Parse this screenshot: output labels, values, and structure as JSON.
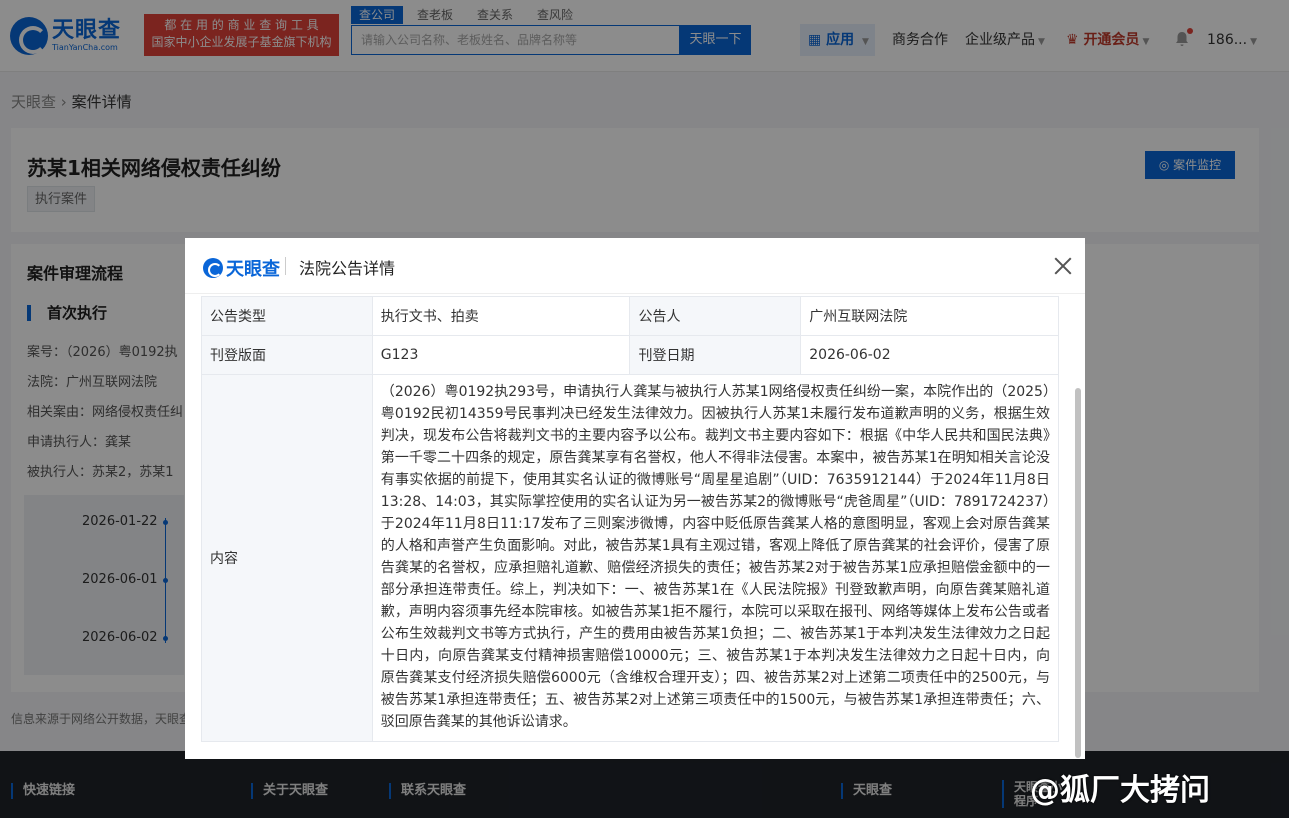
{
  "header": {
    "logo_cn": "天眼查",
    "logo_en": "TianYanCha.com",
    "slogan_line1": "都 在 用 的 商 业 查 询 工 具",
    "slogan_line2": "国家中小企业发展子基金旗下机构",
    "search_tabs": [
      "查公司",
      "查老板",
      "查关系",
      "查风险"
    ],
    "search_placeholder": "请输入公司名称、老板姓名、品牌名称等",
    "search_button": "天眼一下",
    "nav_apps": "应用",
    "nav_business": "商务合作",
    "nav_enterprise": "企业级产品",
    "nav_vip": "开通会员",
    "nav_user": "186..."
  },
  "breadcrumb": {
    "root": "天眼查",
    "sep": "›",
    "current": "案件详情"
  },
  "case": {
    "title": "苏某1相关网络侵权责任纠纷",
    "tag": "执行案件",
    "monitor_button": "案件监控"
  },
  "process": {
    "title": "案件审理流程",
    "subtitle": "首次执行",
    "fields": [
      "案号：（2026）粤0192执",
      "法院：广州互联网法院",
      "相关案由：网络侵权责任纠",
      "申请执行人：龚某",
      "被执行人：苏某2，苏某1"
    ],
    "dates": [
      "2026-01-22",
      "2026-06-01",
      "2026-06-02"
    ]
  },
  "disclaimer": "信息来源于网络公开数据，天眼查",
  "footer": {
    "items": [
      "快速链接",
      "关于天眼查",
      "联系天眼查",
      "天眼查",
      "天眼查小程序"
    ]
  },
  "watermark": "@狐厂大拷问",
  "modal": {
    "logo": "天眼查",
    "title": "法院公告详情",
    "rows": {
      "type_label": "公告类型",
      "type_value": "执行文书、拍卖",
      "publisher_label": "公告人",
      "publisher_value": "广州互联网法院",
      "page_label": "刊登版面",
      "page_value": "G123",
      "date_label": "刊登日期",
      "date_value": "2026-06-02",
      "content_label": "内容",
      "content_value": "（2026）粤0192执293号，申请执行人龚某与被执行人苏某1网络侵权责任纠纷一案，本院作出的（2025）粤0192民初14359号民事判决已经发生法律效力。因被执行人苏某1未履行发布道歉声明的义务，根据生效判决，现发布公告将裁判文书的主要内容予以公布。裁判文书主要内容如下：根据《中华人民共和国民法典》第一千零二十四条的规定，原告龚某享有名誉权，他人不得非法侵害。本案中，被告苏某1在明知相关言论没有事实依据的前提下，使用其实名认证的微博账号“周星星追剧”（UID：7635912144）于2024年11月8日13:28、14:03，其实际掌控使用的实名认证为另一被告苏某2的微博账号“虎爸周星”（UID：7891724237）于2024年11月8日11:17发布了三则案涉微博，内容中贬低原告龚某人格的意图明显，客观上会对原告龚某的人格和声誉产生负面影响。对此，被告苏某1具有主观过错，客观上降低了原告龚某的社会评价，侵害了原告龚某的名誉权，应承担赔礼道歉、赔偿经济损失的责任；被告苏某2对于被告苏某1应承担赔偿金额中的一部分承担连带责任。综上，判决如下：一、被告苏某1在《人民法院报》刊登致歉声明，向原告龚某赔礼道歉，声明内容须事先经本院审核。如被告苏某1拒不履行，本院可以采取在报刊、网络等媒体上发布公告或者公布生效裁判文书等方式执行，产生的费用由被告苏某1负担；二、被告苏某1于本判决发生法律效力之日起十日内，向原告龚某支付精神损害赔偿10000元；三、被告苏某1于本判决发生法律效力之日起十日内，向原告龚某支付经济损失赔偿6000元（含维权合理开支）；四、被告苏某2对上述第二项责任中的2500元，与被告苏某1承担连带责任；五、被告苏某2对上述第三项责任中的1500元，与被告苏某1承担连带责任；六、驳回原告龚某的其他诉讼请求。"
    }
  }
}
